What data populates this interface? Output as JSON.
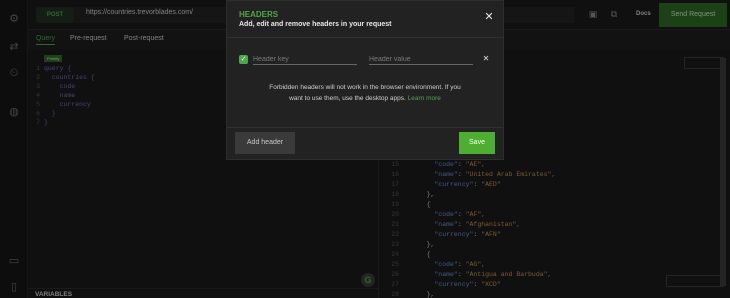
{
  "topbar": {
    "method": "POST",
    "url": "https://countries.trevorblades.com/",
    "docs_label": "Docs",
    "send_label": "Send Request"
  },
  "tabs": [
    {
      "label": "Query",
      "active": true
    },
    {
      "label": "Pre-request",
      "active": false
    },
    {
      "label": "Post-request",
      "active": false
    }
  ],
  "editor": {
    "prettify_label": "Prettify",
    "lines": [
      {
        "num": "1",
        "text": "query {"
      },
      {
        "num": "2",
        "text": "  countries {"
      },
      {
        "num": "3",
        "text": "    code"
      },
      {
        "num": "4",
        "text": "    name"
      },
      {
        "num": "5",
        "text": "    currency"
      },
      {
        "num": "6",
        "text": "  }"
      },
      {
        "num": "7",
        "text": "}"
      }
    ]
  },
  "variables_label": "VARIABLES",
  "response": {
    "lines": [
      {
        "num": "15",
        "key": "\"code\"",
        "value": "\"AE\","
      },
      {
        "num": "16",
        "key": "\"name\"",
        "value": "\"United Arab Emirates\","
      },
      {
        "num": "17",
        "key": "\"currency\"",
        "value": "\"AED\""
      },
      {
        "num": "18",
        "punct": "},"
      },
      {
        "num": "19",
        "punct": "{"
      },
      {
        "num": "20",
        "key": "\"code\"",
        "value": "\"AF\","
      },
      {
        "num": "21",
        "key": "\"name\"",
        "value": "\"Afghanistan\","
      },
      {
        "num": "22",
        "key": "\"currency\"",
        "value": "\"AFN\""
      },
      {
        "num": "23",
        "punct": "},"
      },
      {
        "num": "24",
        "punct": "{"
      },
      {
        "num": "25",
        "key": "\"code\"",
        "value": "\"AG\","
      },
      {
        "num": "26",
        "key": "\"name\"",
        "value": "\"Antigua and Barbuda\","
      },
      {
        "num": "27",
        "key": "\"currency\"",
        "value": "\"XCD\""
      },
      {
        "num": "28",
        "punct": "},"
      }
    ]
  },
  "modal": {
    "title": "HEADERS",
    "subtitle": "Add, edit and remove headers in your request",
    "key_placeholder": "Header key",
    "value_placeholder": "Header value",
    "notice_text": "Forbidden headers will not work in the browser environment. If you want to use them, use the desktop apps.",
    "notice_link": "Learn more",
    "add_header_label": "Add header",
    "save_label": "Save"
  },
  "colors": {
    "accent": "#4aa84a",
    "save_button": "#4caf2f",
    "send_button": "#2b6b22",
    "json_key": "#6f8fd8",
    "json_string": "#c9924a"
  }
}
